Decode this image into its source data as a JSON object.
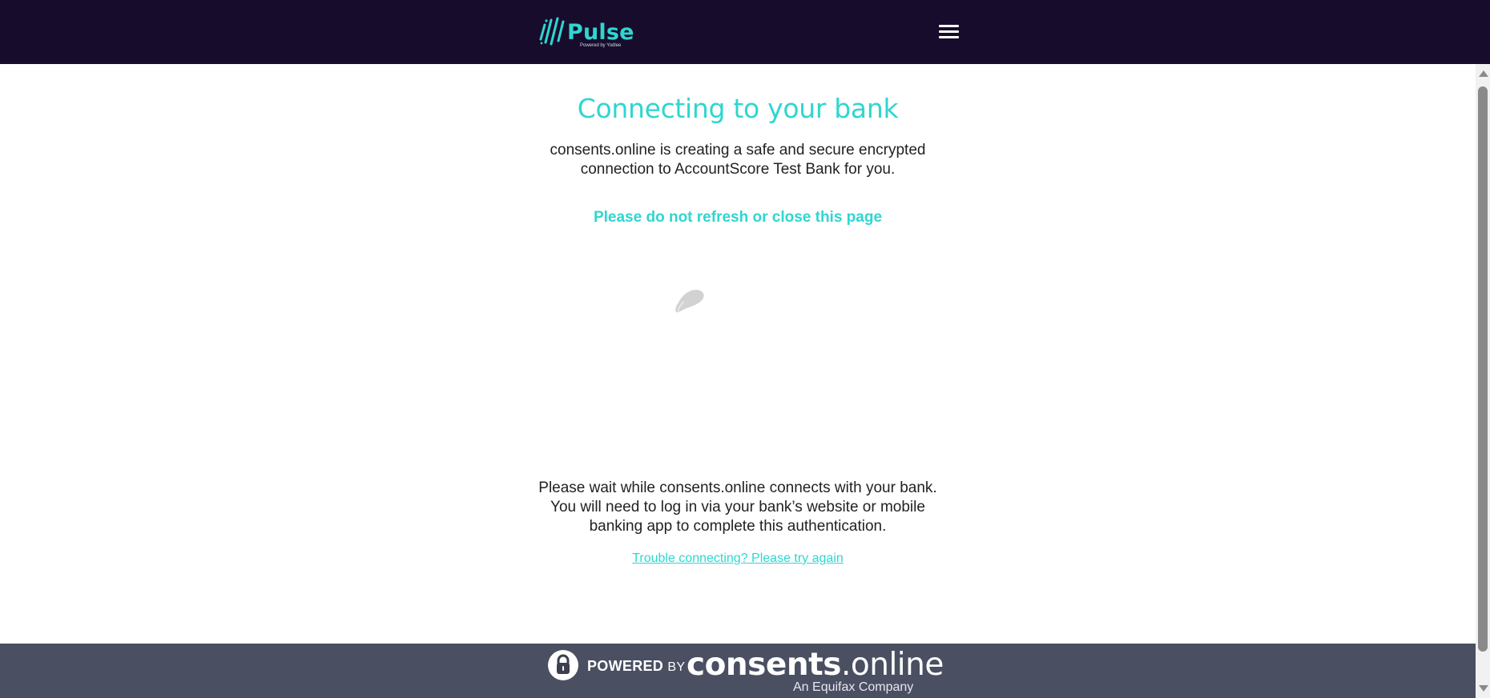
{
  "header": {
    "logo_text": "Pulse",
    "logo_subtext": "Powered by Yodlee",
    "menu_icon": "hamburger-menu-icon"
  },
  "main": {
    "title": "Connecting to your bank",
    "intro_lines": [
      "consents.online is creating a safe and secure encrypted",
      "connection to AccountScore Test Bank for you."
    ],
    "warning": "Please do not refresh or close this page",
    "spinner_icon": "loading-spinner-icon",
    "wait_lines": [
      "Please wait while consents.online connects with your bank.",
      "You will need to log in via your bank’s website or mobile",
      "banking app to complete this authentication."
    ],
    "retry_link": "Trouble connecting? Please try again"
  },
  "footer": {
    "lock_icon": "padlock-icon",
    "powered_label": "POWERED",
    "powered_by": "BY",
    "brand_bold": "consents",
    "brand_rest": ".online",
    "brand_sub": "An Equifax Company"
  },
  "colors": {
    "header_bg": "#180c2c",
    "accent": "#2fd6d0",
    "footer_bg": "#4a4f62",
    "text": "#222222"
  }
}
